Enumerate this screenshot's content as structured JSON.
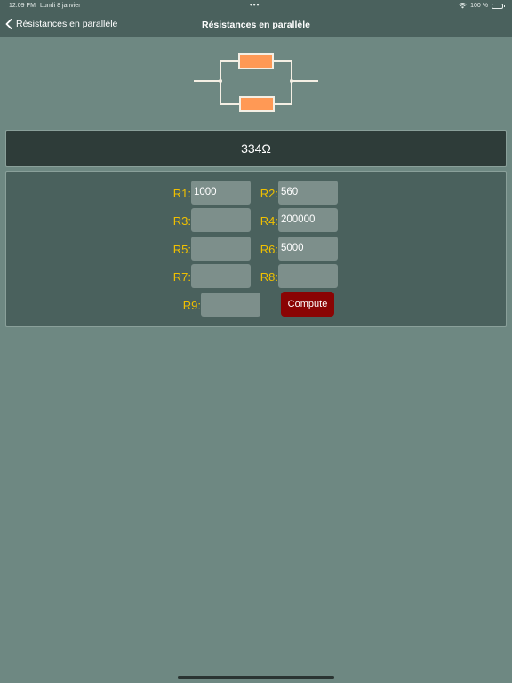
{
  "status_bar": {
    "time": "12:09 PM",
    "date": "Lundi 8 janvier",
    "dots": "•••",
    "battery": "100 %",
    "icons": [
      "wifi-icon",
      "battery-icon"
    ]
  },
  "nav": {
    "back_label": "Résistances en parallèle",
    "title": "Résistances en parallèle"
  },
  "result": "334Ω",
  "fields": [
    {
      "label": "R1:",
      "value": "1000"
    },
    {
      "label": "R2:",
      "value": "560"
    },
    {
      "label": "R3:",
      "value": ""
    },
    {
      "label": "R4:",
      "value": "200000"
    },
    {
      "label": "R5:",
      "value": ""
    },
    {
      "label": "R6:",
      "value": "5000"
    },
    {
      "label": "R7:",
      "value": ""
    },
    {
      "label": "R8:",
      "value": ""
    },
    {
      "label": "R9:",
      "value": ""
    }
  ],
  "compute_label": "Compute",
  "colors": {
    "background": "#6e8882",
    "bar": "#4a615d",
    "result_panel": "#2e3c39",
    "label": "#f0c000",
    "resistor": "#ff9955",
    "button": "#8a0404"
  }
}
